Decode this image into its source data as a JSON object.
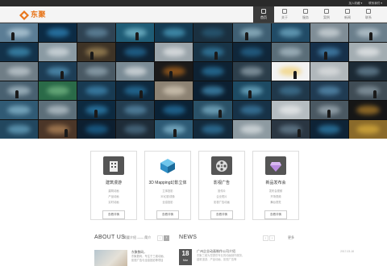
{
  "topbar": {
    "links": [
      "加入收藏 ▾",
      "联系我们 ▾"
    ]
  },
  "header": {
    "logo_text": "东聚",
    "nav": [
      {
        "label": "首页",
        "icon": "home-icon",
        "active": true
      },
      {
        "label": "关于",
        "icon": "person-icon",
        "active": false
      },
      {
        "label": "服务",
        "icon": "service-icon",
        "active": false
      },
      {
        "label": "案例",
        "icon": "case-icon",
        "active": false
      },
      {
        "label": "新闻",
        "icon": "news-icon",
        "active": false
      },
      {
        "label": "联系",
        "icon": "contact-icon",
        "active": false
      }
    ]
  },
  "mosaic": {
    "tiles": [
      {
        "bg": "#5b7d95",
        "glow": "#d9ecf5"
      },
      {
        "bg": "#0c2b44",
        "glow": "#3aa4e3"
      },
      {
        "bg": "#2f4353",
        "glow": "#7aa7c2"
      },
      {
        "bg": "#1f5c76",
        "glow": "#9ee3f2"
      },
      {
        "bg": "#143a52",
        "glow": "#5ec2e6"
      },
      {
        "bg": "#1a3040",
        "glow": "#2e6d8e"
      },
      {
        "bg": "#3f5f73",
        "glow": "#b6dbe8"
      },
      {
        "bg": "#214b66",
        "glow": "#8fd0ea"
      },
      {
        "bg": "#7f8d96",
        "glow": "#eef3f5"
      },
      {
        "bg": "#6b7f8c",
        "glow": "#dce8ee"
      },
      {
        "bg": "#13324a",
        "glow": "#4fb3e0"
      },
      {
        "bg": "#8a9aa3",
        "glow": "#f0f4f6"
      },
      {
        "bg": "#3e3326",
        "glow": "#c7a86b"
      },
      {
        "bg": "#0f2233",
        "glow": "#2a88c1"
      },
      {
        "bg": "#9aa4aa",
        "glow": "#ffffff"
      },
      {
        "bg": "#183447",
        "glow": "#3f9bc9"
      },
      {
        "bg": "#10273a",
        "glow": "#2f7fb0"
      },
      {
        "bg": "#5a6d78",
        "glow": "#c9dbe4"
      },
      {
        "bg": "#16304a",
        "glow": "#5aa9dc"
      },
      {
        "bg": "#a3adb2",
        "glow": "#ffffff"
      },
      {
        "bg": "#6f7d86",
        "glow": "#e3ebef"
      },
      {
        "bg": "#1d3d55",
        "glow": "#69b7e1"
      },
      {
        "bg": "#495964",
        "glow": "#b0c6d2"
      },
      {
        "bg": "#7a8b95",
        "glow": "#ffffff"
      },
      {
        "bg": "#1a1a1a",
        "glow": "#e07f1e"
      },
      {
        "bg": "#0e2233",
        "glow": "#3398cf"
      },
      {
        "bg": "#2c3e4b",
        "glow": "#b8c9d2"
      },
      {
        "bg": "#f2f2f2",
        "glow": "#f2c74d"
      },
      {
        "bg": "#b0b7bb",
        "glow": "#eeeeee"
      },
      {
        "bg": "#1c2a35",
        "glow": "#88aac0"
      },
      {
        "bg": "#486070",
        "glow": "#d2e4ec"
      },
      {
        "bg": "#2a6a48",
        "glow": "#8fd39a"
      },
      {
        "bg": "#183a52",
        "glow": "#4ea6d8"
      },
      {
        "bg": "#0f2a3f",
        "glow": "#2f8fc6"
      },
      {
        "bg": "#8c8273",
        "glow": "#f1e6d2"
      },
      {
        "bg": "#0c2032",
        "glow": "#56b6e8"
      },
      {
        "bg": "#1d4a63",
        "glow": "#93d6ef"
      },
      {
        "bg": "#20384a",
        "glow": "#4d8db2"
      },
      {
        "bg": "#203b52",
        "glow": "#6eb0d9"
      },
      {
        "bg": "#3f4c55",
        "glow": "#a9bbc6"
      },
      {
        "bg": "#305a74",
        "glow": "#a8dcf0"
      },
      {
        "bg": "#5c6e79",
        "glow": "#dfe8ed"
      },
      {
        "bg": "#0d2a40",
        "glow": "#3ba3dd"
      },
      {
        "bg": "#233d50",
        "glow": "#6ea9cc"
      },
      {
        "bg": "#0b2235",
        "glow": "#2d90cc"
      },
      {
        "bg": "#2a5167",
        "glow": "#9bd5ec"
      },
      {
        "bg": "#173247",
        "glow": "#4a99c8"
      },
      {
        "bg": "#b5bcc0",
        "glow": "#ffffff"
      },
      {
        "bg": "#4a5862",
        "glow": "#c4d3db"
      },
      {
        "bg": "#161616",
        "glow": "#e8a532"
      },
      {
        "bg": "#22475f",
        "glow": "#82c7e6"
      },
      {
        "bg": "#4b3628",
        "glow": "#d9a36b"
      },
      {
        "bg": "#0d1f30",
        "glow": "#1f7fba"
      },
      {
        "bg": "#1e2c38",
        "glow": "#5f8aa6"
      },
      {
        "bg": "#2d5a75",
        "glow": "#a4dbf1"
      },
      {
        "bg": "#132a3c",
        "glow": "#3b95c9"
      },
      {
        "bg": "#8d9aa1",
        "glow": "#f5f8f9"
      },
      {
        "bg": "#2a3642",
        "glow": "#7f9db0"
      },
      {
        "bg": "#0e2336",
        "glow": "#3aa0d8"
      },
      {
        "bg": "#8a6a2a",
        "glow": "#f5c542"
      }
    ]
  },
  "services": [
    {
      "title": "建筑漫游",
      "icon": "building-icon",
      "lines": [
        "建筑动画",
        "产品动画",
        "实时动画"
      ],
      "button": "查看详情"
    },
    {
      "title": "3D Mapping幻影立体",
      "icon": "cube-icon",
      "lines": [
        "立体投影",
        "3D幻影成像",
        "全息投影"
      ],
      "button": "查看详情"
    },
    {
      "title": "影视广告",
      "icon": "film-reel-icon",
      "lines": [
        "宣传片",
        "企业短片",
        "影视广告动画"
      ],
      "button": "查看详情"
    },
    {
      "title": "新品发布会",
      "icon": "diamond-icon",
      "lines": [
        "发布会视频",
        "开场视频",
        "舞台视觉"
      ],
      "button": "查看详情"
    }
  ],
  "about": {
    "title": "ABOUT US",
    "subtitle": "简要介绍 —— 简介",
    "snippet_title": "东聚数码，",
    "snippet_lines": [
      "东聚数码，专注于三维动画、",
      "影视广告与全息投影等项目"
    ]
  },
  "news": {
    "title": "NEWS",
    "more": "更多",
    "date_day": "18",
    "date_month": "Mar",
    "item_title": "广州企业动画制作公司介绍",
    "item_desc_lines": [
      "东聚三维为您提供专业的动画制作服务，",
      "建筑漫游、产品动画、影视广告等"
    ],
    "item_time": "2017-03-18"
  }
}
